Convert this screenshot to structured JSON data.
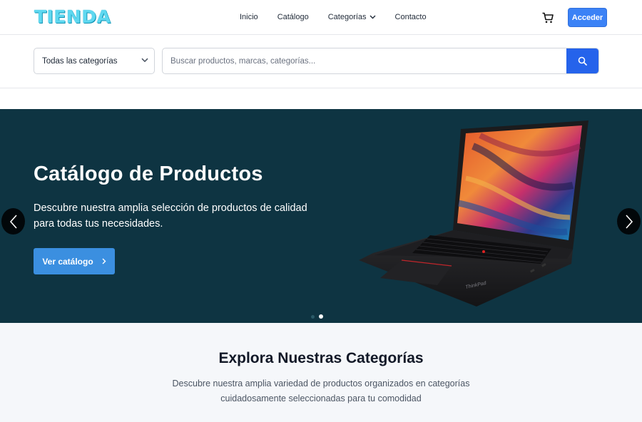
{
  "brand": {
    "logo_text": "TIENDA",
    "accent_color": "#5fd8f0"
  },
  "nav": {
    "links": [
      {
        "label": "Inicio"
      },
      {
        "label": "Catálogo"
      },
      {
        "label": "Categorías"
      },
      {
        "label": "Contacto"
      }
    ],
    "cart_icon": "shopping-cart-icon",
    "login_label": "Acceder",
    "login_color": "#3b82f6"
  },
  "search": {
    "category_selected": "Todas las categorías",
    "placeholder": "Buscar productos, marcas, categorías...",
    "button_icon": "search-icon",
    "button_color": "#2563eb"
  },
  "hero": {
    "title": "Catálogo de Productos",
    "description": "Descubre nuestra amplia selección de productos de calidad para todas tus necesidades.",
    "cta_label": "Ver catálogo",
    "background_color": "#0e3442",
    "slide_count": 2,
    "active_slide": 2,
    "laptop_brand": "ThinkPad"
  },
  "categories_section": {
    "title": "Explora Nuestras Categorías",
    "description": "Descubre nuestra amplia variedad de productos organizados en categorías cuidadosamente seleccionadas para tu comodidad"
  }
}
